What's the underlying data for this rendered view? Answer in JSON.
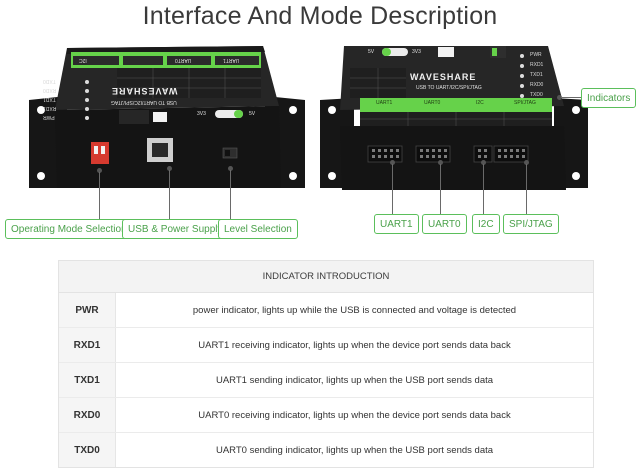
{
  "page_title": "Interface And Mode Description",
  "left_device": {
    "brand": "WAVESHARE",
    "model": "USB TO UART/I2C/SPI/JTAG",
    "leds": [
      "TXD0",
      "RXD0",
      "TXD1",
      "RXD1",
      "PWR"
    ],
    "voltage_labels": [
      "3V3",
      "5V"
    ],
    "top_tabs": [
      "I2C",
      "UART0",
      "UART1"
    ]
  },
  "right_device": {
    "brand": "WAVESHARE",
    "model": "USB TO UART/I2C/SPI/JTAG",
    "leds": [
      "PWR",
      "RXD1",
      "TXD1",
      "RXD0",
      "TXD0"
    ],
    "voltage_labels": [
      "5V",
      "3V3"
    ],
    "front_tabs": [
      "UART1",
      "UART0",
      "I2C",
      "SPI/JTAG"
    ]
  },
  "callouts": {
    "operating_mode": "Operating Mode Selection",
    "usb_power": "USB & Power Supply",
    "level_selection": "Level Selection",
    "indicators": "Indicators",
    "uart1": "UART1",
    "uart0": "UART0",
    "i2c": "I2C",
    "spi_jtag": "SPI/JTAG"
  },
  "table": {
    "header": "INDICATOR INTRODUCTION",
    "rows": [
      {
        "name": "PWR",
        "desc": "power indicator, lights up while the USB is connected and voltage is detected"
      },
      {
        "name": "RXD1",
        "desc": "UART1 receiving indicator, lights up when the device port sends data back"
      },
      {
        "name": "TXD1",
        "desc": "UART1 sending indicator, lights up when the USB port sends data"
      },
      {
        "name": "RXD0",
        "desc": "UART0 receiving indicator, lights up when the device port sends data back"
      },
      {
        "name": "TXD0",
        "desc": "UART0 sending indicator, lights up when the USB port sends data"
      }
    ]
  },
  "colors": {
    "accent_green": "#5bbf5b",
    "label_green": "#66d24a",
    "device_body": "#1c1c1c"
  }
}
